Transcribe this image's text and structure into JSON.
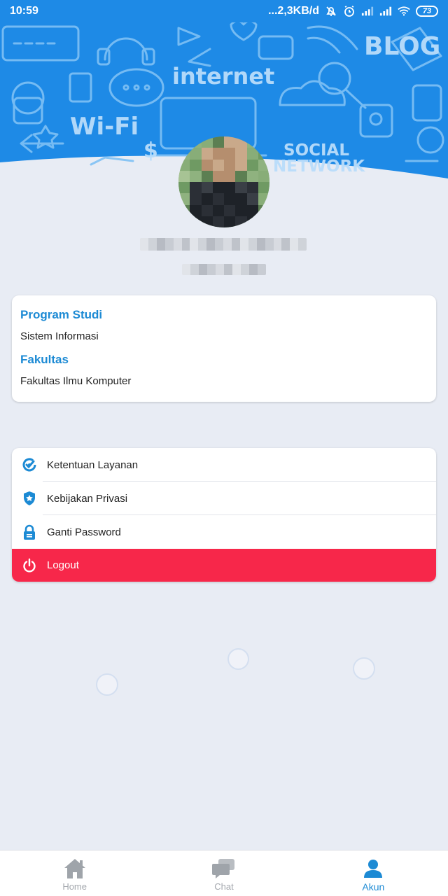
{
  "status_bar": {
    "time": "10:59",
    "network_speed": "...2,3KB/d",
    "battery": "73",
    "icons": [
      "bell-off-icon",
      "alarm-icon",
      "signal-icon",
      "signal-icon",
      "wifi-icon",
      "battery-icon"
    ]
  },
  "header": {
    "banner_words": [
      "internet",
      "Wi-Fi",
      "SOCIAL",
      "NETWORK",
      "BLOG"
    ]
  },
  "profile": {
    "avatar": "avatar-photo-pixelated",
    "name_redacted": true,
    "id_redacted": true
  },
  "info": {
    "program_label": "Program Studi",
    "program_value": "Sistem Informasi",
    "faculty_label": "Fakultas",
    "faculty_value": "Fakultas Ilmu Komputer"
  },
  "menu": {
    "terms": {
      "label": "Ketentuan Layanan",
      "icon": "clock-check-icon"
    },
    "privacy": {
      "label": "Kebijakan Privasi",
      "icon": "shield-star-icon"
    },
    "password": {
      "label": "Ganti Password",
      "icon": "lock-icon"
    },
    "logout": {
      "label": "Logout",
      "icon": "power-icon"
    }
  },
  "bottom_nav": {
    "home": {
      "label": "Home",
      "icon": "home-icon"
    },
    "chat": {
      "label": "Chat",
      "icon": "chat-icon"
    },
    "account": {
      "label": "Akun",
      "icon": "person-icon",
      "active": true
    }
  },
  "colors": {
    "primary": "#1e8ae6",
    "accent_text": "#1c8ad4",
    "logout": "#f7274a",
    "background": "#e8ecf4"
  }
}
